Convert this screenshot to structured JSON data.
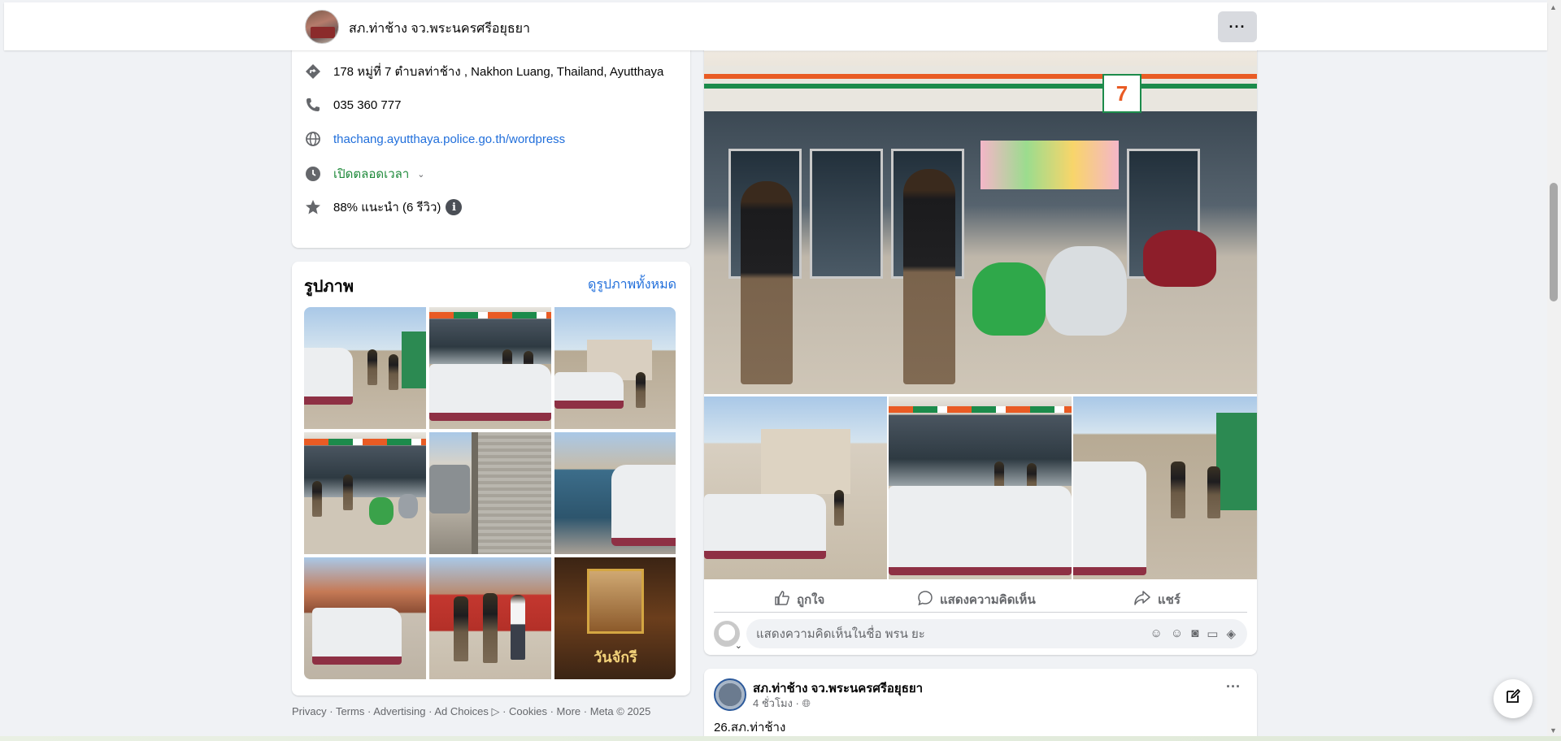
{
  "header": {
    "page_name": "สภ.ท่าช้าง จว.พระนครศรีอยุธยา",
    "more_icon": "more-horizontal-icon"
  },
  "intro": {
    "address": "178 หมู่ที่ 7 ตำบลท่าช้าง , Nakhon Luang, Thailand, Ayutthaya",
    "phone": "035 360 777",
    "website": "thachang.ayutthaya.police.go.th/wordpress",
    "hours": "เปิดตลอดเวลา",
    "rating": "88% แนะนำ (6 รีวิว)",
    "info_badge": "i",
    "icons": [
      "directions-icon",
      "phone-icon",
      "globe-icon",
      "clock-icon",
      "star-icon"
    ],
    "accent_green": "#1f8a3b",
    "link_blue": "#216fdb"
  },
  "photos": {
    "title": "รูปภาพ",
    "see_all": "ดูรูปภาพทั้งหมด",
    "poster_caption": "วันจักรี"
  },
  "post": {
    "actions": {
      "like": "ถูกใจ",
      "comment": "แสดงความคิดเห็น",
      "share": "แชร์"
    },
    "comment_placeholder": "แสดงความคิดเห็นในชื่อ พรน ยะ",
    "comment_tools": [
      "avatar-sticker-icon",
      "emoji-icon",
      "camera-icon",
      "gif-icon",
      "sticker-icon"
    ],
    "store_logo": "7"
  },
  "post2": {
    "page_name": "สภ.ท่าช้าง จว.พระนครศรีอยุธยา",
    "meta": "4 ชั่วโมง ·",
    "text": "26.สภ.ท่าช้าง"
  },
  "footer": {
    "privacy": "Privacy",
    "terms": "Terms",
    "advertising": "Advertising",
    "ad_choices": "Ad Choices",
    "cookies": "Cookies",
    "more": "More",
    "meta": "Meta © 2025"
  }
}
